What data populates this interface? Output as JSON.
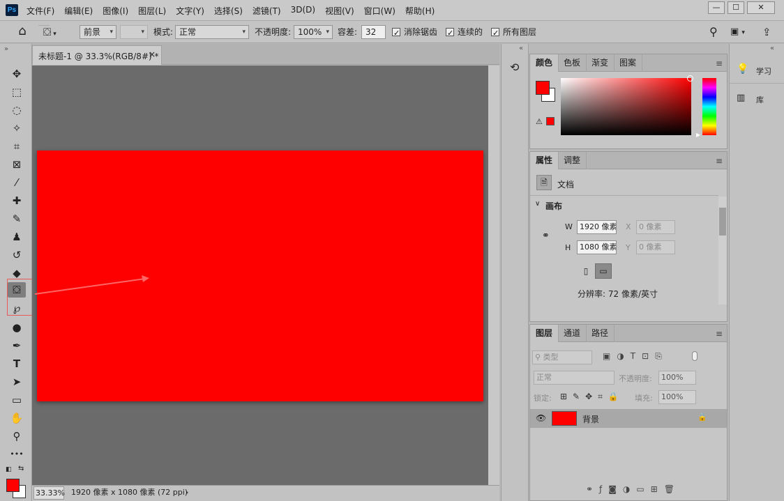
{
  "app": {
    "logo": "Ps"
  },
  "menu": [
    "文件(F)",
    "编辑(E)",
    "图像(I)",
    "图层(L)",
    "文字(Y)",
    "选择(S)",
    "滤镜(T)",
    "3D(D)",
    "视图(V)",
    "窗口(W)",
    "帮助(H)"
  ],
  "window_controls": {
    "minimize": "—",
    "maximize": "☐",
    "close": "✕"
  },
  "options": {
    "fill_source": "前景",
    "mode_label": "模式:",
    "mode_value": "正常",
    "opacity_label": "不透明度:",
    "opacity_value": "100%",
    "tolerance_label": "容差:",
    "tolerance_value": "32",
    "antialias_label": "消除锯齿",
    "contiguous_label": "连续的",
    "all_layers_label": "所有图层"
  },
  "document": {
    "tab_title": "未标题-1 @ 33.3%(RGB/8#) *",
    "tab_close": "×",
    "zoom": "33.33%",
    "doc_info": "1920 像素 x 1080 像素 (72 ppi)",
    "status_arrow": "›",
    "canvas_color": "#ff0000"
  },
  "color_panel": {
    "tabs": [
      "颜色",
      "色板",
      "渐变",
      "图案"
    ],
    "foreground_color": "#ff0000",
    "background_color": "#ffffff"
  },
  "properties_panel": {
    "tabs": [
      "属性",
      "调整"
    ],
    "doc_label": "文档",
    "section_title": "画布",
    "w_label": "W",
    "w_value": "1920 像素",
    "h_label": "H",
    "h_value": "1080 像素",
    "x_label": "X",
    "x_value": "0 像素",
    "y_label": "Y",
    "y_value": "0 像素",
    "resolution": "分辨率: 72 像素/英寸"
  },
  "layers_panel": {
    "tabs": [
      "图层",
      "通道",
      "路径"
    ],
    "filter_placeholder": "类型",
    "blend_mode": "正常",
    "opacity_label": "不透明度:",
    "opacity_value": "100%",
    "lock_label": "锁定:",
    "fill_label": "填充:",
    "fill_value": "100%",
    "layer_name": "背景",
    "layer_color": "#ff0000"
  },
  "right_dock": {
    "learn_label": "学习",
    "library_label": "库"
  },
  "tools": [
    {
      "name": "move-tool",
      "glyph": "✥"
    },
    {
      "name": "marquee-tool",
      "glyph": "⬚"
    },
    {
      "name": "lasso-tool",
      "glyph": "◌"
    },
    {
      "name": "magic-wand-tool",
      "glyph": "✧"
    },
    {
      "name": "crop-tool",
      "glyph": "⌗"
    },
    {
      "name": "frame-tool",
      "glyph": "⊠"
    },
    {
      "name": "eyedropper-tool",
      "glyph": "⁄"
    },
    {
      "name": "healing-brush-tool",
      "glyph": "✚"
    },
    {
      "name": "brush-tool",
      "glyph": "✎"
    },
    {
      "name": "clone-stamp-tool",
      "glyph": "♟"
    },
    {
      "name": "history-brush-tool",
      "glyph": "↺"
    },
    {
      "name": "eraser-tool",
      "glyph": "◆"
    },
    {
      "name": "paint-bucket-tool",
      "glyph": "⛋"
    },
    {
      "name": "blur-tool",
      "glyph": "℘"
    },
    {
      "name": "dodge-tool",
      "glyph": "●"
    },
    {
      "name": "pen-tool",
      "glyph": "✒"
    },
    {
      "name": "type-tool",
      "glyph": "T"
    },
    {
      "name": "path-selection-tool",
      "glyph": "➤"
    },
    {
      "name": "rectangle-tool",
      "glyph": "▭"
    },
    {
      "name": "hand-tool",
      "glyph": "✋"
    },
    {
      "name": "zoom-tool",
      "glyph": "⚲"
    },
    {
      "name": "more-tools",
      "glyph": "•••"
    }
  ]
}
